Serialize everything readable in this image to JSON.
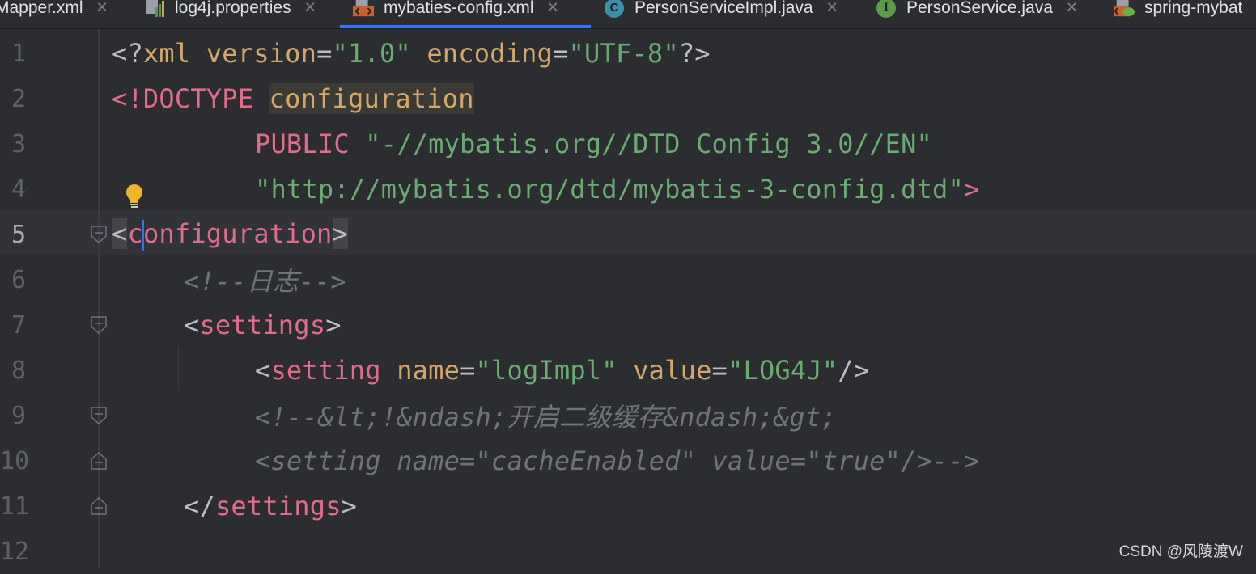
{
  "tabs": [
    {
      "label": "Mapper.xml",
      "icon": "xml-file-icon",
      "active": false
    },
    {
      "label": "log4j.properties",
      "icon": "properties-file-icon",
      "active": false
    },
    {
      "label": "mybaties-config.xml",
      "icon": "xml-file-icon",
      "active": true
    },
    {
      "label": "PersonServiceImpl.java",
      "icon": "class-icon",
      "active": false
    },
    {
      "label": "PersonService.java",
      "icon": "interface-icon",
      "active": false
    },
    {
      "label": "spring-mybat",
      "icon": "spring-xml-file-icon",
      "active": false
    }
  ],
  "close_glyph": "✕",
  "class_glyph": "C",
  "interface_glyph": "I",
  "colors": {
    "accent": "#3574f0",
    "tag": "#e06c8a",
    "attribute": "#d3a66b",
    "string": "#6aab73",
    "comment": "#6f737a",
    "background": "#2b2d30"
  },
  "editor": {
    "current_line": 5,
    "line_numbers": [
      "1",
      "2",
      "3",
      "4",
      "5",
      "6",
      "7",
      "8",
      "9",
      "10",
      "11",
      "12"
    ],
    "lines": {
      "l1": {
        "a": "<?",
        "b": "xml ",
        "c": "version",
        "d": "=",
        "e": "\"1.0\"",
        "f": " ",
        "g": "encoding",
        "h": "=",
        "i": "\"UTF-8\"",
        "j": "?>"
      },
      "l2": {
        "a": "<!DOCTYPE ",
        "b": "configuration"
      },
      "l3": {
        "a": "PUBLIC ",
        "b": "\"-//mybatis.org//DTD Config 3.0//EN\""
      },
      "l4": {
        "a": "\"http://mybatis.org/dtd/mybatis-3-config.dtd\"",
        "b": ">"
      },
      "l5": {
        "a": "<",
        "b": "c",
        "c": "onfiguration",
        "d": ">"
      },
      "l6": {
        "a": "<!--日志-->"
      },
      "l7": {
        "a": "<",
        "b": "settings",
        "c": ">"
      },
      "l8": {
        "a": "<",
        "b": "setting",
        "c": " ",
        "d": "name",
        "e": "=",
        "f": "\"logImpl\"",
        "g": " ",
        "h": "value",
        "i": "=",
        "j": "\"LOG4J\"",
        "k": "/>"
      },
      "l9": {
        "a": "<!--&lt;!&ndash;开启二级缓存&ndash;&gt;"
      },
      "l10": {
        "a": "<setting name=\"cacheEnabled\" value=\"true\"/>-->"
      },
      "l11": {
        "a": "</",
        "b": "settings",
        "c": ">"
      },
      "l12": {}
    }
  },
  "watermark": "CSDN @风陵渡W"
}
